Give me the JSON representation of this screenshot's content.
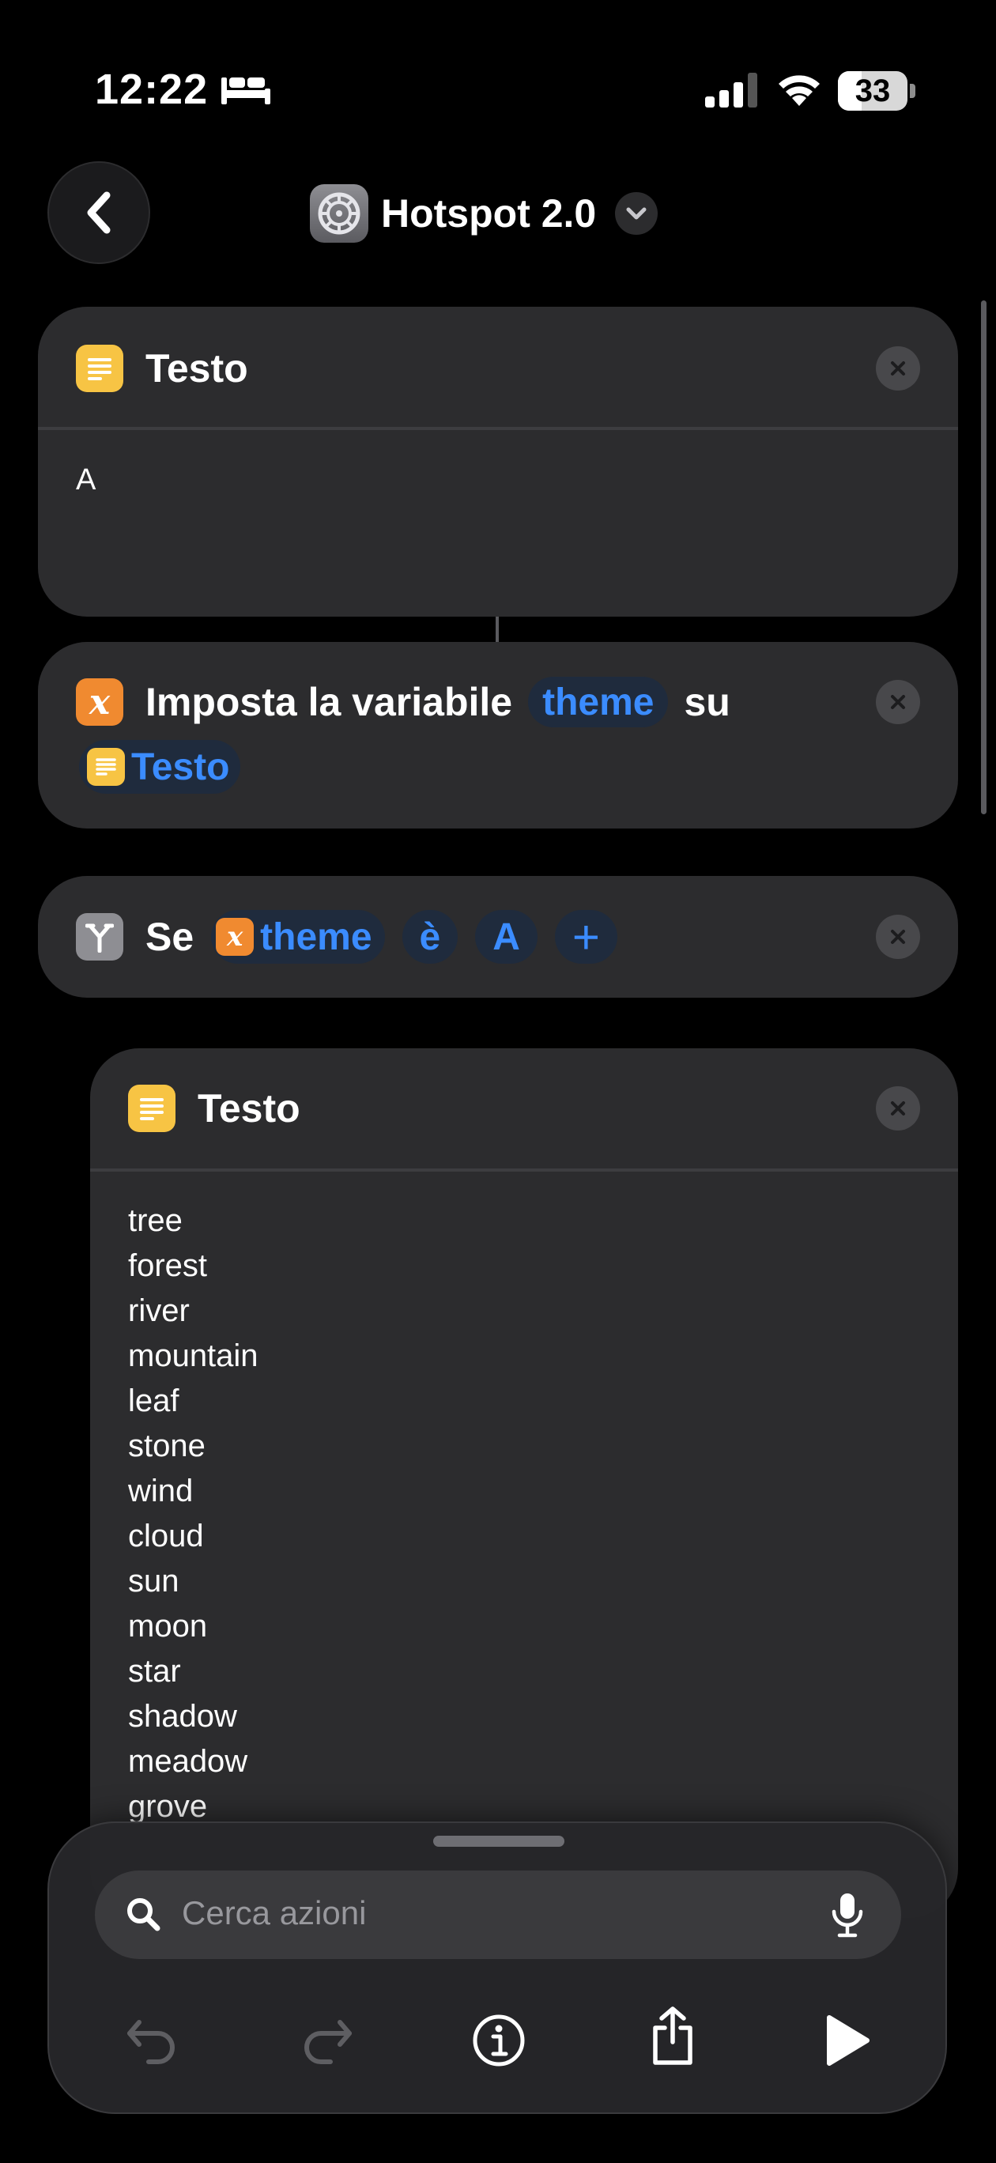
{
  "status_bar": {
    "time": "12:22",
    "battery_level": "33",
    "icons": [
      "bed-icon",
      "cellular-signal-icon",
      "wifi-icon",
      "battery-icon"
    ]
  },
  "nav": {
    "title": "Hotspot 2.0",
    "app_icon": "settings-gear-icon"
  },
  "actions": {
    "text1": {
      "header": "Testo",
      "content": "A"
    },
    "set_variable": {
      "label": "Imposta la variabile",
      "variable": "theme",
      "on_label": "su",
      "value": "Testo"
    },
    "if_block": {
      "label": "Se",
      "variable": "theme",
      "condition": "è",
      "value": "A",
      "add_symbol": "+"
    },
    "text2": {
      "header": "Testo",
      "lines": [
        "tree",
        "forest",
        "river",
        "mountain",
        "leaf",
        "stone",
        "wind",
        "cloud",
        "sun",
        "moon",
        "star",
        "shadow",
        "meadow",
        "grove"
      ]
    }
  },
  "bottom_sheet": {
    "search_placeholder": "Cerca azioni"
  },
  "colors": {
    "accent": "#3b8cff",
    "text_action": "#f7c444",
    "variable_action": "#f08a30",
    "card_bg": "#2c2c2e"
  }
}
